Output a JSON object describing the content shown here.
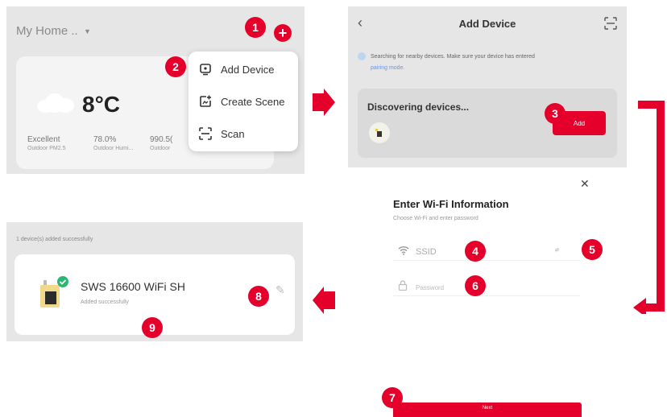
{
  "home_screen": {
    "home_name": "My Home ..",
    "menu": {
      "items": [
        {
          "label": "Add Device",
          "icon": "add-device-icon"
        },
        {
          "label": "Create Scene",
          "icon": "create-scene-icon"
        },
        {
          "label": "Scan",
          "icon": "scan-icon"
        }
      ]
    },
    "weather": {
      "temperature": "8°C",
      "stats": [
        {
          "value": "Excellent",
          "label": "Outdoor PM2.5"
        },
        {
          "value": "78.0%",
          "label": "Outdoor Humi..."
        },
        {
          "value": "990.5(",
          "label": "Outdoor"
        }
      ]
    }
  },
  "add_device_screen": {
    "title": "Add Device",
    "searching_text": "Searching for nearby devices. Make sure your device has entered",
    "pairing_link": "pairing mode.",
    "discovering_title": "Discovering devices...",
    "add_button": "Add"
  },
  "wifi_screen": {
    "title": "Enter Wi-Fi Information",
    "subtitle": "Choose Wi-Fi and enter password",
    "ssid_placeholder": "SSID",
    "password_placeholder": "Password",
    "switch_link": "⇄",
    "next_button": "Next"
  },
  "success_screen": {
    "header": "1 device(s) added successfully",
    "device_name": "SWS 16600 WiFi SH",
    "device_status": "Added successfully"
  },
  "step_markers": [
    "1",
    "2",
    "3",
    "4",
    "5",
    "6",
    "7",
    "8",
    "9"
  ],
  "colors": {
    "accent": "#e4002b",
    "panel_bg": "#e6e6e6",
    "card_bg": "#f4f4f4",
    "success_green": "#2bb673"
  }
}
